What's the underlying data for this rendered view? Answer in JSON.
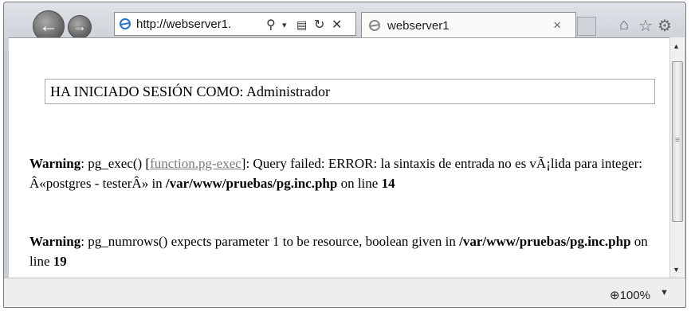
{
  "browser": {
    "address_url": "http://webserver1.",
    "address_controls": [
      "search-icon",
      "dropdown",
      "compat-view-icon",
      "refresh-icon",
      "stop-icon"
    ],
    "tab_title": "webserver1",
    "tab_close": "×",
    "zoom": "100%",
    "icons": [
      "back-icon",
      "forward-icon",
      "home-icon",
      "favorites-star-icon",
      "settings-gear-icon"
    ]
  },
  "page": {
    "login_text": "HA INICIADO SESIÓN COMO: Administrador",
    "warning1": {
      "label": "Warning",
      "text_a": ": pg_exec() [",
      "link": "function.pg-exec",
      "text_b": "]: Query failed: ERROR: la sintaxis de entrada no es vÃ¡lida para integer: Â«postgres - testerÂ» in ",
      "path": "/var/www/pruebas/pg.inc.php",
      "text_c": " on line ",
      "line": "14"
    },
    "warning2": {
      "label": "Warning",
      "text_a": ": pg_numrows() expects parameter 1 to be resource, boolean given in ",
      "path": "/var/www/pruebas/pg.inc.php",
      "text_c": " on line ",
      "line": "19"
    }
  }
}
